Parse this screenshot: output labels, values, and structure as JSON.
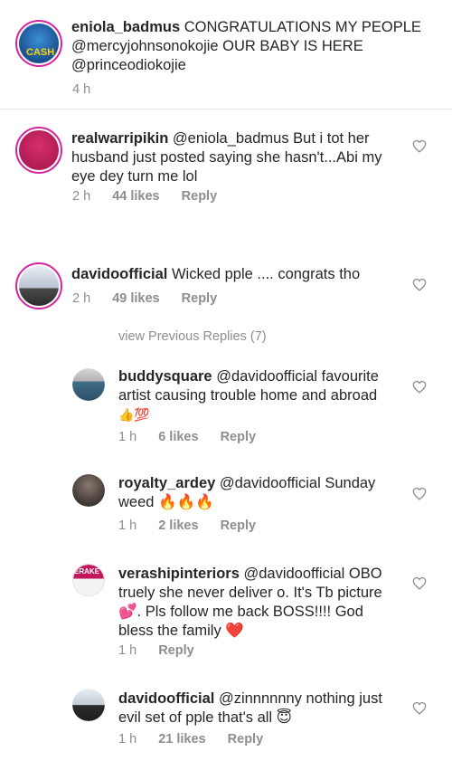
{
  "comments": [
    {
      "username": "eniola_badmus",
      "text": "CONGRATULATIONS MY PEOPLE @mercyjohnsonokojie OUR BABY IS HERE @princeodiokojie",
      "lines": [
        "CONGRATULATIONS MY PEOPLE",
        "@mercyjohnsonokojie OUR BABY IS HERE",
        "@princeodiokojie"
      ],
      "time": "4 h",
      "avatar_text": "CASH"
    },
    {
      "username": "realwarripikin",
      "lines": [
        "@eniola_badmus But i tot her",
        "husband just posted saying she hasn't...Abi my",
        "eye dey turn me lol"
      ],
      "time": "2 h",
      "likes": "44 likes",
      "reply": "Reply"
    },
    {
      "username": "davidoofficial",
      "lines": [
        "Wicked pple .... congrats tho"
      ],
      "time": "2 h",
      "likes": "49 likes",
      "reply": "Reply"
    }
  ],
  "view_previous": "view Previous Replies (7)",
  "replies": [
    {
      "username": "buddysquare",
      "lines": [
        "@davidoofficial favourite",
        "artist causing trouble home and abroad",
        "👍💯"
      ],
      "time": "1 h",
      "likes": "6 likes",
      "reply": "Reply"
    },
    {
      "username": "royalty_ardey",
      "lines": [
        "@davidoofficial Sunday",
        "weed 🔥🔥🔥"
      ],
      "time": "1 h",
      "likes": "2 likes",
      "reply": "Reply"
    },
    {
      "username": "verashipinteriors",
      "lines": [
        "@davidoofficial OBO",
        "truely she never deliver o. It's Tb picture",
        "💕. Pls follow me back BOSS!!!! God",
        "bless the family ❤️"
      ],
      "time": "1 h",
      "reply": "Reply",
      "avatar_text": "ERAKE"
    },
    {
      "username": "davidoofficial",
      "lines": [
        "@zinnnnnny nothing just",
        "evil set of pple that's all 😇"
      ],
      "time": "1 h",
      "likes": "21 likes",
      "reply": "Reply"
    }
  ],
  "colors": {
    "text": "#262626",
    "meta": "#8e8e8e",
    "ring": "#d6249f"
  }
}
